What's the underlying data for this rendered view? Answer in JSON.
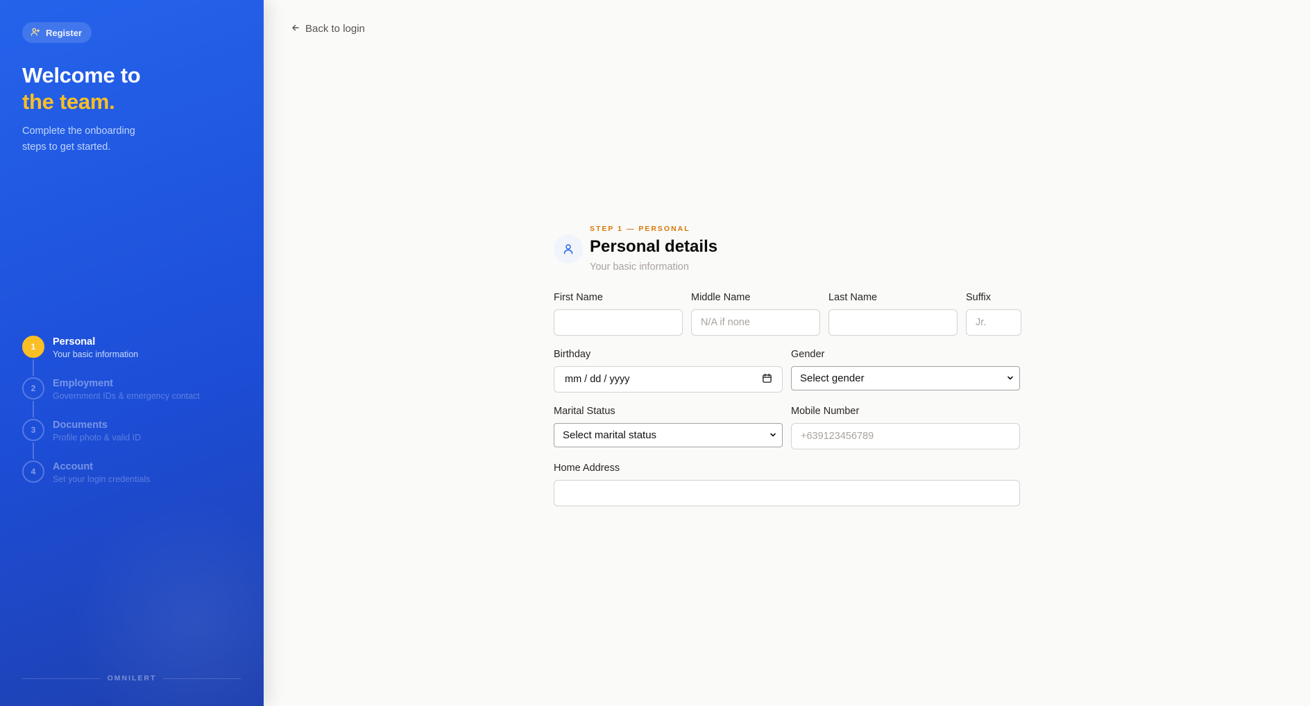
{
  "sidebar": {
    "register_label": "Register",
    "hero_line1": "Welcome to",
    "hero_line2": "the team.",
    "subtitle": "Complete the onboarding steps to get started.",
    "steps": [
      {
        "number": "1",
        "label": "Personal",
        "desc": "Your basic information",
        "active": true
      },
      {
        "number": "2",
        "label": "Employment",
        "desc": "Government IDs & emergency contact",
        "active": false
      },
      {
        "number": "3",
        "label": "Documents",
        "desc": "Profile photo & valid ID",
        "active": false
      },
      {
        "number": "4",
        "label": "Account",
        "desc": "Set your login credentials",
        "active": false
      }
    ],
    "brand": "OMNILERT"
  },
  "main": {
    "back_label": "Back to login",
    "step_kicker": "STEP 1 — PERSONAL",
    "title": "Personal details",
    "subtitle": "Your basic information",
    "fields": {
      "first_name": {
        "label": "First Name",
        "value": "",
        "placeholder": ""
      },
      "middle_name": {
        "label": "Middle Name",
        "value": "",
        "placeholder": "N/A if none"
      },
      "last_name": {
        "label": "Last Name",
        "value": "",
        "placeholder": ""
      },
      "suffix": {
        "label": "Suffix",
        "value": "",
        "placeholder": "Jr."
      },
      "birthday": {
        "label": "Birthday",
        "display": "mm / dd / yyyy"
      },
      "gender": {
        "label": "Gender",
        "selected": "Select gender"
      },
      "marital_status": {
        "label": "Marital Status",
        "selected": "Select marital status"
      },
      "mobile_number": {
        "label": "Mobile Number",
        "value": "",
        "placeholder": "+639123456789"
      },
      "home_address": {
        "label": "Home Address",
        "value": "",
        "placeholder": ""
      }
    }
  },
  "colors": {
    "sidebar_blue": "#2563eb",
    "accent_amber": "#fbbf24",
    "kicker_orange": "#d97706",
    "page_bg": "#fafaf9"
  },
  "icons": {
    "register": "user-plus-icon",
    "back": "arrow-left-icon",
    "header": "user-icon",
    "birthday": "calendar-icon",
    "select": "chevron-down-icon"
  }
}
